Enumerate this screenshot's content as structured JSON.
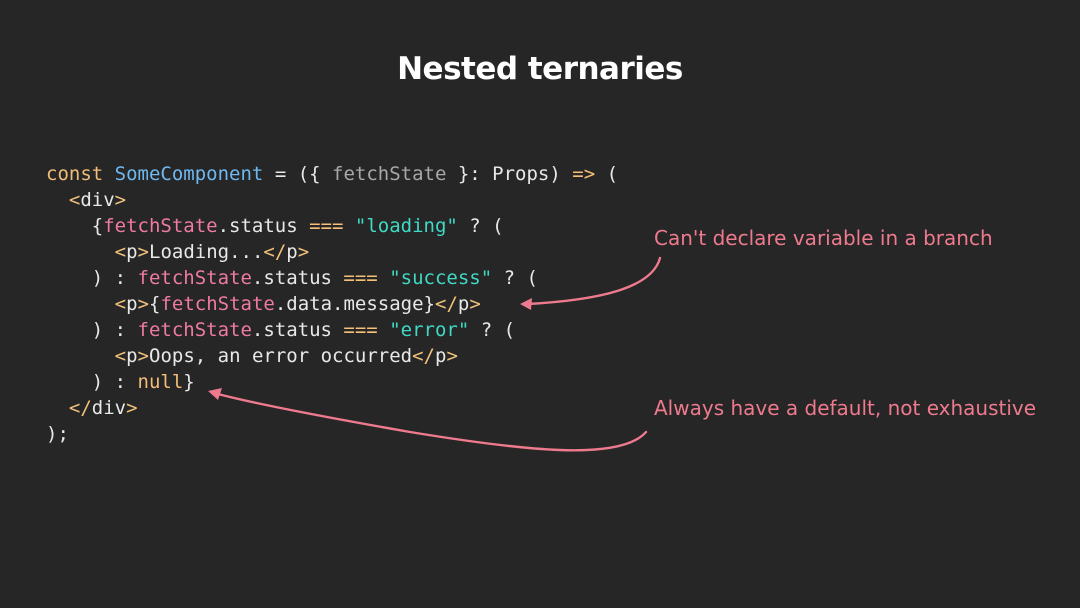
{
  "slide": {
    "title": "Nested ternaries"
  },
  "code": {
    "l1": {
      "t1": "const",
      "t2": " ",
      "t3": "SomeComponent",
      "t4": " = ({ ",
      "t5": "fetchState",
      "t6": " }: Props) ",
      "t7": "=>",
      "t8": " ("
    },
    "l2": {
      "t1": "  ",
      "t2": "<",
      "t3": "div",
      "t4": ">"
    },
    "l3": {
      "t1": "    {",
      "t2": "fetchState",
      "t3": ".status ",
      "t4": "===",
      "t5": " ",
      "t6": "\"loading\"",
      "t7": " ? ("
    },
    "l4": {
      "t1": "      ",
      "t2": "<",
      "t3": "p",
      "t4": ">",
      "t5": "Loading...",
      "t6": "</",
      "t7": "p",
      "t8": ">"
    },
    "l5": {
      "t1": "    ) : ",
      "t2": "fetchState",
      "t3": ".status ",
      "t4": "===",
      "t5": " ",
      "t6": "\"success\"",
      "t7": " ? ("
    },
    "l6": {
      "t1": "      ",
      "t2": "<",
      "t3": "p",
      "t4": ">",
      "t5": "{",
      "t6": "fetchState",
      "t7": ".data.message}",
      "t8": "</",
      "t9": "p",
      "t10": ">"
    },
    "l7": {
      "t1": "    ) : ",
      "t2": "fetchState",
      "t3": ".status ",
      "t4": "===",
      "t5": " ",
      "t6": "\"error\"",
      "t7": " ? ("
    },
    "l8": {
      "t1": "      ",
      "t2": "<",
      "t3": "p",
      "t4": ">",
      "t5": "Oops, an error occurred",
      "t6": "</",
      "t7": "p",
      "t8": ">"
    },
    "l9": {
      "t1": "    ) : ",
      "t2": "null",
      "t3": "}"
    },
    "l10": {
      "t1": "  ",
      "t2": "</",
      "t3": "div",
      "t4": ">"
    },
    "l11": {
      "t1": ");"
    }
  },
  "annotations": {
    "branch_note": "Can't declare variable in a branch",
    "default_note": "Always have a default, not exhaustive"
  },
  "colors": {
    "background": "#262626",
    "annotation": "#ee7a8e",
    "keyword": "#f2bd79",
    "function_name": "#6fb8f0",
    "string": "#3fd9c4",
    "variable": "#ef7aa3",
    "text": "#e8e8e8"
  }
}
